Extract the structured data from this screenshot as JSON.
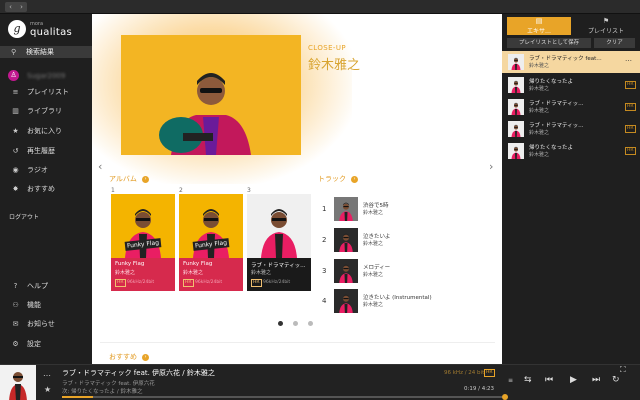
{
  "window": {
    "back": "‹",
    "forward": "›"
  },
  "sidebar": {
    "logo_letter": "g",
    "logo_small": "mora",
    "logo_main": "qualitas",
    "search_label": "検索結果",
    "user_name": "Sugar2009",
    "nav": [
      {
        "icon": "playlist-icon",
        "glyph": "≡",
        "label": "プレイリスト"
      },
      {
        "icon": "library-icon",
        "glyph": "▥",
        "label": "ライブラリ"
      },
      {
        "icon": "star-icon",
        "glyph": "★",
        "label": "お気に入り"
      },
      {
        "icon": "history-icon",
        "glyph": "↺",
        "label": "再生履歴"
      },
      {
        "icon": "radio-icon",
        "glyph": "◉",
        "label": "ラジオ"
      },
      {
        "icon": "recommend-icon",
        "glyph": "✸",
        "label": "おすすめ"
      }
    ],
    "logout": "ログアウト",
    "bottom": [
      {
        "icon": "help-icon",
        "glyph": "?",
        "label": "ヘルプ"
      },
      {
        "icon": "feature-icon",
        "glyph": "⚇",
        "label": "機能"
      },
      {
        "icon": "notice-icon",
        "glyph": "✉",
        "label": "お知らせ"
      },
      {
        "icon": "settings-icon",
        "glyph": "⚙",
        "label": "設定"
      }
    ]
  },
  "hero": {
    "label": "CLOSE-UP",
    "artist": "鈴木雅之"
  },
  "albums": {
    "title": "アルバム",
    "arrow": "›",
    "items": [
      {
        "num": "1",
        "title": "Funky Flag",
        "artist": "鈴木雅之",
        "hr": "HR",
        "format": "96kHz/24bit",
        "cover_text": "Funky Flag",
        "bg": "#d62a4d"
      },
      {
        "num": "2",
        "title": "Funky Flag",
        "artist": "鈴木雅之",
        "hr": "HR",
        "format": "96kHz/24bit",
        "cover_text": "Funky Flag",
        "bg": "#d62a4d"
      },
      {
        "num": "3",
        "title": "ラブ・ドラマティッ…",
        "artist": "鈴木雅之",
        "hr": "HR",
        "format": "96kHz/24bit",
        "cover_text": "",
        "bg": "#1a1a1a"
      }
    ]
  },
  "tracks": {
    "title": "トラック",
    "arrow": "›",
    "items": [
      {
        "num": "1",
        "title": "渋谷で5時",
        "artist": "鈴木雅之"
      },
      {
        "num": "2",
        "title": "泣きたいよ",
        "artist": "鈴木雅之"
      },
      {
        "num": "3",
        "title": "メロディー",
        "artist": "鈴木雅之"
      },
      {
        "num": "4",
        "title": "泣きたいよ (Instrumental)",
        "artist": "鈴木雅之"
      }
    ]
  },
  "recommend": {
    "title": "おすすめ",
    "arrow": "›"
  },
  "carousel": {
    "prev": "‹",
    "next": "›",
    "pages": 3,
    "active": 0
  },
  "queue": {
    "tab_active": "エキサ…",
    "tab_inactive": "プレイリスト",
    "save_label": "プレイリストとして保存",
    "clear_label": "クリア",
    "items": [
      {
        "title": "ラブ・ドラマティック feat…",
        "artist": "鈴木雅之",
        "badge": "…",
        "selected": true
      },
      {
        "title": "帰りたくなったよ",
        "artist": "鈴木雅之",
        "badge": "HR",
        "selected": false
      },
      {
        "title": "ラブ・ドラマティッ…",
        "artist": "鈴木雅之",
        "badge": "HR",
        "selected": false
      },
      {
        "title": "ラブ・ドラマティッ…",
        "artist": "鈴木雅之",
        "badge": "HR",
        "selected": false
      },
      {
        "title": "帰りたくなったよ",
        "artist": "鈴木雅之",
        "badge": "HR",
        "selected": false
      }
    ]
  },
  "player": {
    "title": "ラブ・ドラマティック feat. 伊原六花 / 鈴木雅之",
    "subtitle": "ラブ・ドラマティック feat. 伊原六花",
    "next": "次: 帰りたくなったよ / 鈴木雅之",
    "format": "96 kHz / 24 bit",
    "hr": "HR",
    "time": "0:19 / 4:23",
    "progress": 0.07,
    "vol_label": "≡",
    "controls": [
      "⇆",
      "⏮",
      "▶",
      "⏭",
      "↻"
    ],
    "fullscreen": "⛶",
    "more": "…",
    "star": "★"
  },
  "colors": {
    "accent": "#e8a428",
    "album_red": "#d62a4d"
  }
}
